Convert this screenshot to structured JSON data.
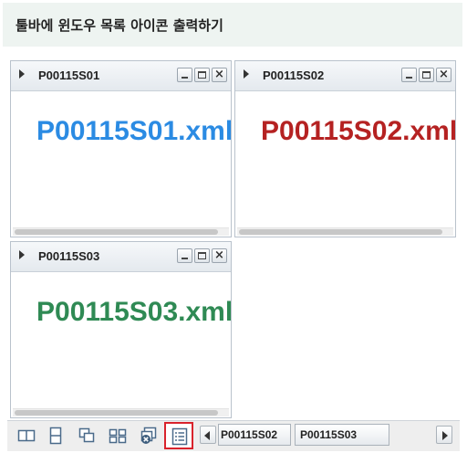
{
  "header": {
    "title": "툴바에 윈도우 목록 아이콘 출력하기"
  },
  "windows": [
    {
      "title": "P00115S01",
      "content": "P00115S01.xml",
      "color": "#2b8be3"
    },
    {
      "title": "P00115S02",
      "content": "P00115S02.xml",
      "color": "#b52222"
    },
    {
      "title": "P00115S03",
      "content": "P00115S03.xml",
      "color": "#2f8a54"
    }
  ],
  "toolbar": {
    "icons": [
      "tile-vertical-icon",
      "tile-horizontal-icon",
      "cascade-icon",
      "tile-grid-icon",
      "close-all-icon",
      "window-list-icon"
    ],
    "tabs": [
      {
        "label": "P00115S02"
      },
      {
        "label": "P00115S03"
      }
    ],
    "accent": "#d9232c"
  }
}
